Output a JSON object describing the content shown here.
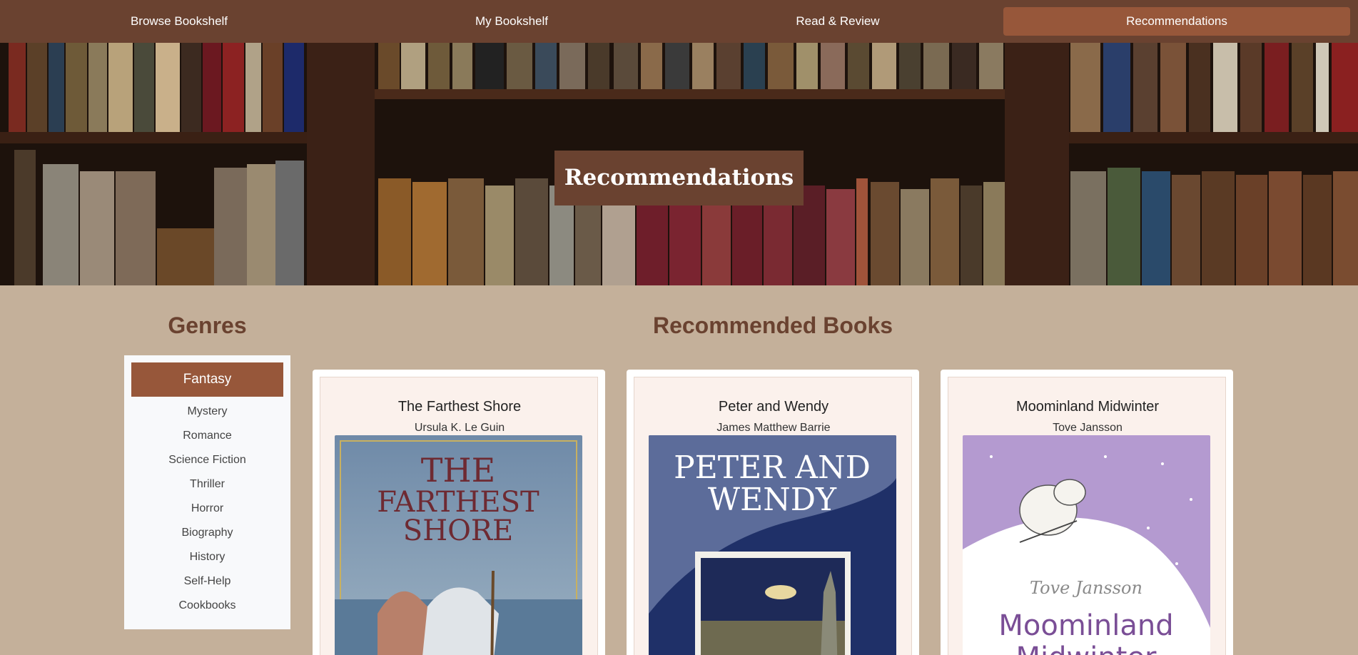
{
  "nav": {
    "items": [
      {
        "label": "Browse Bookshelf"
      },
      {
        "label": "My Bookshelf"
      },
      {
        "label": "Read & Review"
      },
      {
        "label": "Recommendations"
      }
    ],
    "active_index": 3
  },
  "hero": {
    "title": "Recommendations"
  },
  "genres": {
    "heading": "Genres",
    "active": "Fantasy",
    "items": [
      "Mystery",
      "Romance",
      "Science Fiction",
      "Thriller",
      "Horror",
      "Biography",
      "History",
      "Self-Help",
      "Cookbooks"
    ]
  },
  "recommended": {
    "heading": "Recommended Books",
    "books": [
      {
        "title": "The Farthest Shore",
        "author": "Ursula K. Le Guin",
        "cover_text": [
          "THE",
          "FARTHEST",
          "SHORE"
        ]
      },
      {
        "title": "Peter and Wendy",
        "author": "James Matthew Barrie",
        "cover_text": [
          "PETER AND",
          "WENDY"
        ]
      },
      {
        "title": "Moominland Midwinter",
        "author": "Tove Jansson",
        "cover_text": [
          "Tove Jansson",
          "Moominland",
          "Midwinter"
        ]
      }
    ]
  },
  "colors": {
    "nav_bg": "#6a4230",
    "nav_active": "#97573a",
    "page_bg": "#c4b09a",
    "heading": "#6a4230"
  }
}
